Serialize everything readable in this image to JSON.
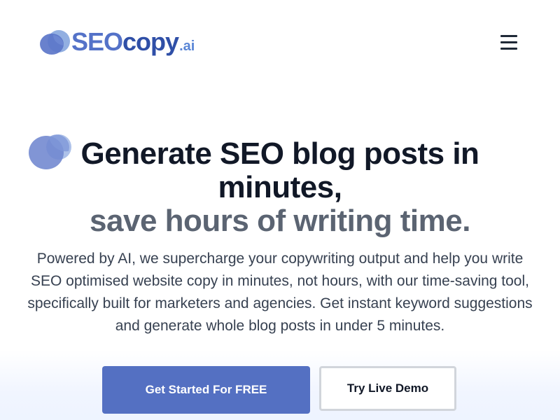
{
  "header": {
    "logo": {
      "seo": "SEO",
      "copy": "copy",
      "ai": ".ai"
    },
    "menu_icon": "hamburger-menu-icon"
  },
  "hero": {
    "headline_line1": "Generate SEO blog posts in",
    "headline_line2": "minutes,",
    "headline_line3": "save hours of writing time.",
    "subtext": "Powered by AI, we supercharge your copywriting output and help you write SEO optimised website copy in minutes, not hours, with our time-saving tool, specifically built for marketers and agencies. Get instant keyword suggestions and generate whole blog posts in under 5 minutes.",
    "primary_cta": "Get Started For FREE",
    "secondary_cta": "Try Live Demo"
  },
  "colors": {
    "brand_blue": "#5470c2",
    "brand_dark_blue": "#2f4fa7",
    "headline": "#111827",
    "headline_muted": "#5b6472",
    "body_text": "#374151"
  }
}
